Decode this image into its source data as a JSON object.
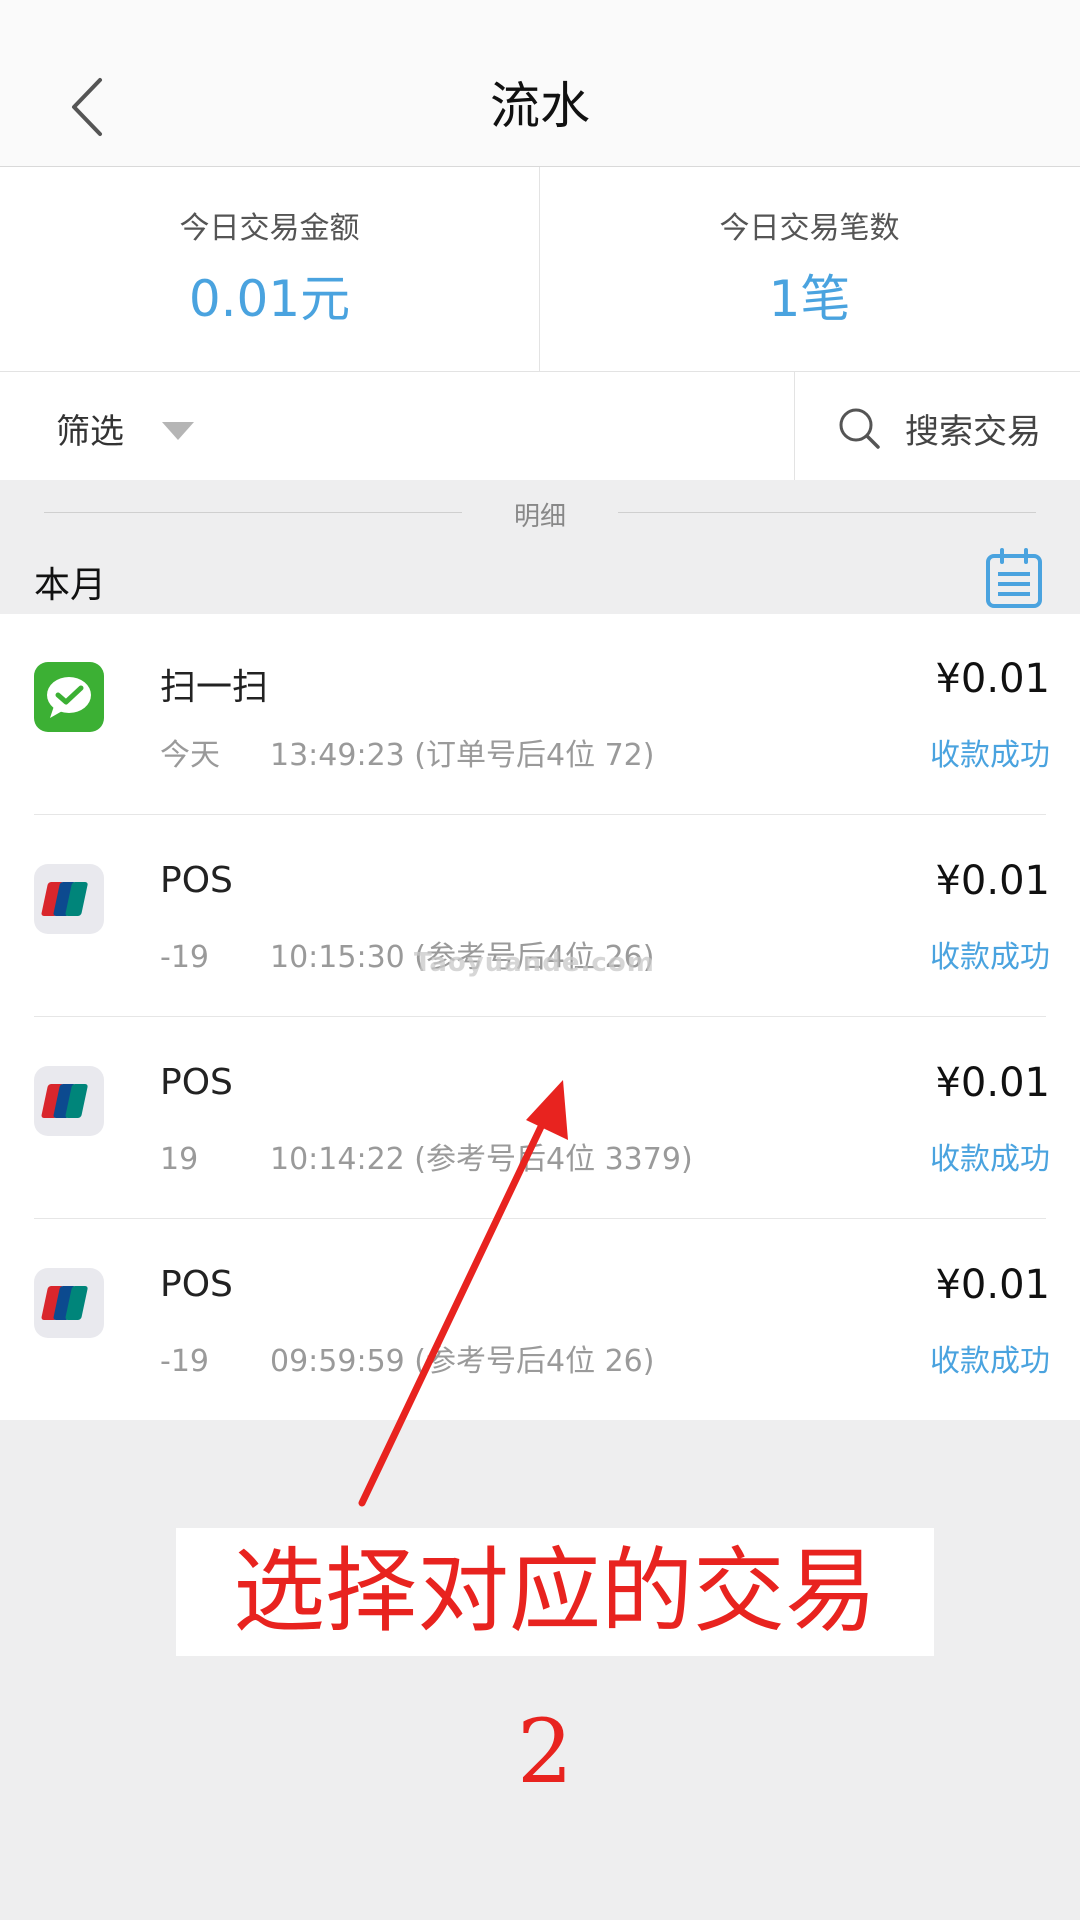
{
  "header": {
    "title": "流水",
    "back_icon": "chevron-left-icon"
  },
  "stats": {
    "amount_label": "今日交易金额",
    "amount_value": "0.01元",
    "count_label": "今日交易笔数",
    "count_value": "1笔",
    "accent_color": "#4aa3df"
  },
  "filter": {
    "label": "筛选",
    "caret_icon": "caret-down-icon",
    "search_label": "搜索交易",
    "search_icon": "search-icon"
  },
  "section": {
    "label": "明细",
    "month": "本月",
    "calendar_icon": "calendar-list-icon"
  },
  "transactions": [
    {
      "icon": "wechat-pay-icon",
      "title": "扫一扫",
      "date": "今天",
      "detail": "13:49:23 (订单号后4位    72)",
      "amount": "¥0.01",
      "status": "收款成功"
    },
    {
      "icon": "unionpay-icon",
      "title": "POS",
      "date": "-19",
      "detail": "10:15:30 (参考号后4位    26)",
      "amount": "¥0.01",
      "status": "收款成功"
    },
    {
      "icon": "unionpay-icon",
      "title": "POS",
      "date": "19",
      "detail": "10:14:22 (参考号后4位 3379)",
      "amount": "¥0.01",
      "status": "收款成功"
    },
    {
      "icon": "unionpay-icon",
      "title": "POS",
      "date": "-19",
      "detail": "09:59:59 (参考号后4位    26)",
      "amount": "¥0.01",
      "status": "收款成功"
    }
  ],
  "overlay": {
    "watermark": "Taoyuande.com",
    "instruction": "选择对应的交易",
    "step": "2",
    "annotation_color": "#e8231f"
  }
}
